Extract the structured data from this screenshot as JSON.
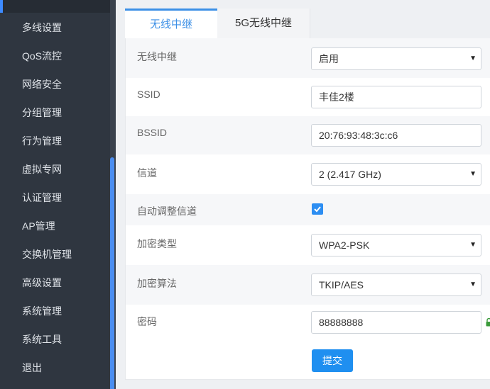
{
  "sidebar": {
    "items": [
      {
        "label": "多线设置"
      },
      {
        "label": "QoS流控"
      },
      {
        "label": "网络安全"
      },
      {
        "label": "分组管理"
      },
      {
        "label": "行为管理"
      },
      {
        "label": "虚拟专网"
      },
      {
        "label": "认证管理"
      },
      {
        "label": "AP管理"
      },
      {
        "label": "交换机管理"
      },
      {
        "label": "高级设置"
      },
      {
        "label": "系统管理"
      },
      {
        "label": "系统工具"
      },
      {
        "label": "退出"
      }
    ]
  },
  "tabs": [
    {
      "label": "无线中继",
      "active": true
    },
    {
      "label": "5G无线中继",
      "active": false
    }
  ],
  "form": {
    "relay": {
      "label": "无线中继",
      "value": "启用"
    },
    "ssid": {
      "label": "SSID",
      "value": "丰佳2楼"
    },
    "bssid": {
      "label": "BSSID",
      "value": "20:76:93:48:3c:c6"
    },
    "channel": {
      "label": "信道",
      "value": "2 (2.417 GHz)"
    },
    "auto_channel": {
      "label": "自动调整信道",
      "checked": true
    },
    "encryption_type": {
      "label": "加密类型",
      "value": "WPA2-PSK"
    },
    "encryption_algo": {
      "label": "加密算法",
      "value": "TKIP/AES"
    },
    "password": {
      "label": "密码",
      "value": "88888888"
    },
    "submit_label": "提交"
  },
  "colors": {
    "accent": "#3b8fe6",
    "sidebar_bg": "#2f3640",
    "button_bg": "#1f8ff0"
  }
}
